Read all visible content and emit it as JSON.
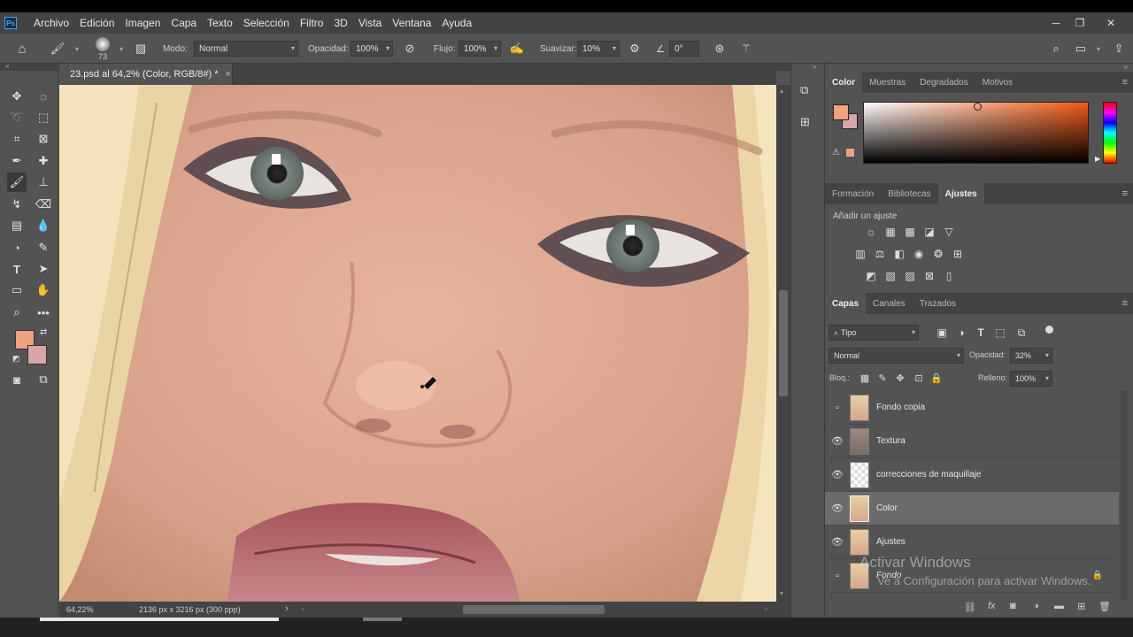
{
  "app": {
    "logo": "Ps"
  },
  "menubar": {
    "items": [
      "Archivo",
      "Edición",
      "Imagen",
      "Capa",
      "Texto",
      "Selección",
      "Filtro",
      "3D",
      "Vista",
      "Ventana",
      "Ayuda"
    ]
  },
  "window_controls": {
    "minimize": "─",
    "restore": "❐",
    "close": "✕"
  },
  "options_bar": {
    "brush_size": "73",
    "mode_label": "Modo:",
    "mode_value": "Normal",
    "opacity_label": "Opacidad:",
    "opacity_value": "100%",
    "flow_label": "Flujo:",
    "flow_value": "100%",
    "smooth_label": "Suavizar:",
    "smooth_value": "10%",
    "angle_value": "0°"
  },
  "document": {
    "tab_title": "23.psd al 64,2% (Color, RGB/8#) *",
    "close": "×"
  },
  "status": {
    "zoom": "64,22%",
    "info": "2136 px x 3216 px (300 ppp)",
    "arrow": "›"
  },
  "colors": {
    "foreground": "#f0a27f",
    "background": "#d9a5a7"
  },
  "color_panel": {
    "tabs": [
      "Color",
      "Muestras",
      "Degradados",
      "Motivos"
    ],
    "active_tab": "Color"
  },
  "adjust_panel": {
    "tabs": [
      "Formación",
      "Bibliotecas",
      "Ajustes"
    ],
    "active_tab": "Ajustes",
    "title": "Añadir un ajuste"
  },
  "layers_panel": {
    "tabs": [
      "Capas",
      "Canales",
      "Trazados"
    ],
    "active_tab": "Capas",
    "filter_value": "Tipo",
    "blend_mode": "Normal",
    "opacity_label": "Opacidad:",
    "opacity_value": "32%",
    "lock_label": "Bloq.:",
    "fill_label": "Relleno:",
    "fill_value": "100%",
    "layers": [
      {
        "name": "Fondo copia",
        "visible": false,
        "selected": false
      },
      {
        "name": "Textura",
        "visible": true,
        "selected": false
      },
      {
        "name": "correcciones de maquillaje",
        "visible": true,
        "selected": false
      },
      {
        "name": "Color",
        "visible": true,
        "selected": true
      },
      {
        "name": "Ajustes",
        "visible": true,
        "selected": false
      },
      {
        "name": "Fondo",
        "visible": false,
        "selected": false
      }
    ]
  },
  "watermark": {
    "line1": "Activar Windows",
    "line2": "Ve a Configuración para activar Windows."
  }
}
